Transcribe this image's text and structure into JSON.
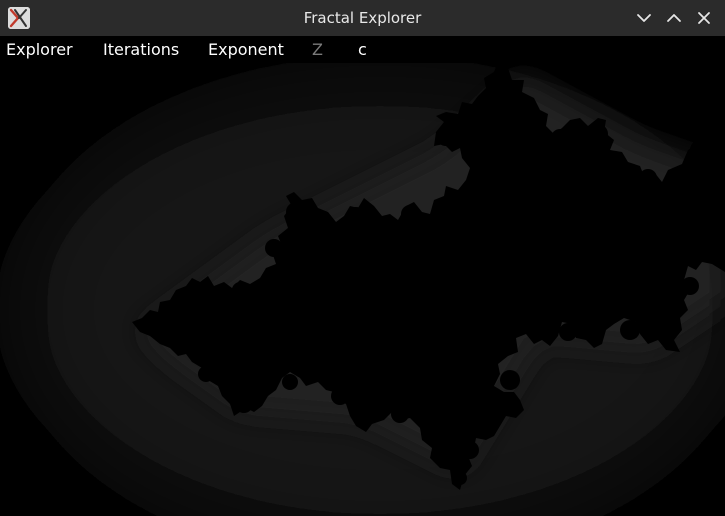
{
  "window": {
    "title": "Fractal Explorer",
    "controls": [
      "minimize-icon",
      "maximize-icon",
      "close-icon"
    ]
  },
  "menu": {
    "items": [
      {
        "label": "Explorer",
        "enabled": true
      },
      {
        "label": "Iterations",
        "enabled": true
      },
      {
        "label": "Exponent",
        "enabled": true
      },
      {
        "label": "Z",
        "enabled": false
      },
      {
        "label": "c",
        "enabled": true
      }
    ]
  },
  "canvas": {
    "content": "julia-set-fractal",
    "background_color": "#000000",
    "glow_color": "#1e1e1e"
  }
}
